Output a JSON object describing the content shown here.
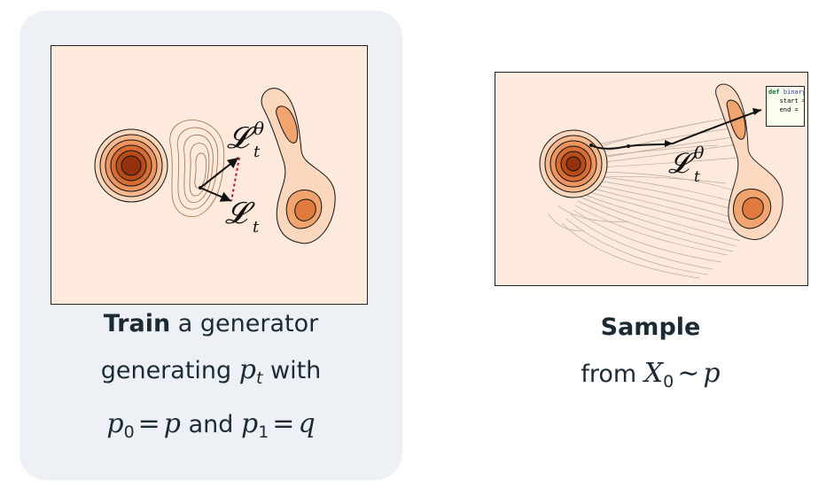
{
  "left_panel": {
    "label_theta": "𝓛",
    "label_theta_sup": "θ",
    "label_theta_sub": "t",
    "label_plain": "𝓛",
    "label_plain_sub": "t"
  },
  "right_panel": {
    "label": "𝓛",
    "label_sup": "θ",
    "label_sub": "t",
    "code_line1_kw": "def",
    "code_line1_fn": "binary",
    "code_line2": "start =",
    "code_line3": "end ="
  },
  "caption_left": {
    "bold": "Train",
    "line1_rest": " a generator",
    "line2_pre": "generating ",
    "p": "p",
    "t": "t",
    "line2_post": " with",
    "p0": "p",
    "zero": "0",
    "eq": "=",
    "pv": "p",
    "and": " and ",
    "p1": "p",
    "one": "1",
    "eq2": "=",
    "q": "q"
  },
  "caption_right": {
    "bold": "Sample",
    "from": "from ",
    "X": "X",
    "zero": "0",
    "sim": "∼",
    "p": "p"
  },
  "colors": {
    "background_card": "#edf1f5",
    "panel_fill": "#fdeadc",
    "density_dark": "#8a2a08",
    "density_light": "#f4b27e",
    "arrow_red": "#c0142c"
  }
}
